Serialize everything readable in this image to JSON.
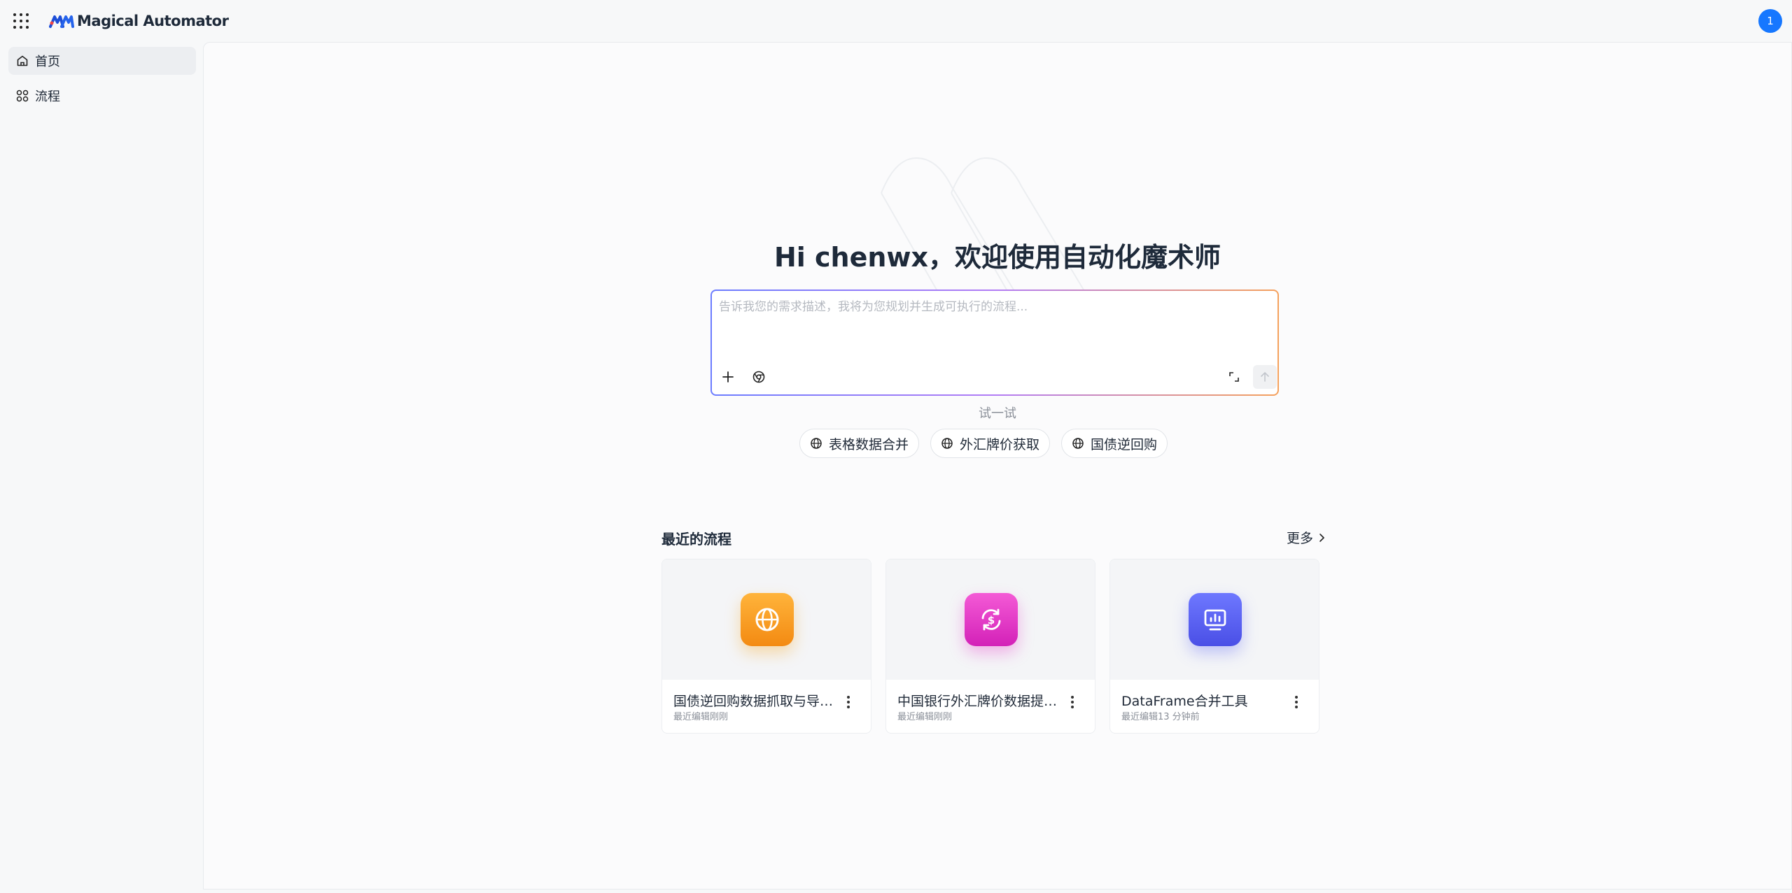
{
  "app": {
    "name": "Magical Automator"
  },
  "user": {
    "avatar_text": "1"
  },
  "sidebar": {
    "items": [
      {
        "label": "首页",
        "icon": "home-icon",
        "active": true
      },
      {
        "label": "流程",
        "icon": "apps-grid-icon",
        "active": false
      }
    ]
  },
  "main": {
    "welcome": "Hi chenwx，欢迎使用自动化魔术师",
    "prompt": {
      "placeholder": "告诉我您的需求描述，我将为您规划并生成可执行的流程...",
      "value": ""
    },
    "try_label": "试一试",
    "suggestions": [
      {
        "label": "表格数据合并",
        "icon": "globe-icon"
      },
      {
        "label": "外汇牌价获取",
        "icon": "globe-icon"
      },
      {
        "label": "国债逆回购",
        "icon": "globe-icon"
      }
    ],
    "recent": {
      "title": "最近的流程",
      "more_label": "更多",
      "cards": [
        {
          "title": "国债逆回购数据抓取与导出...",
          "subtitle": "最近编辑刚刚",
          "icon": "globe-icon",
          "color": "#f7a21b"
        },
        {
          "title": "中国银行外汇牌价数据提取...",
          "subtitle": "最近编辑刚刚",
          "icon": "currency-exchange-icon",
          "color": "#e535c9"
        },
        {
          "title": "DataFrame合并工具",
          "subtitle": "最近编辑13 分钟前",
          "icon": "dashboard-monitor-icon",
          "color": "#5b63f5"
        }
      ]
    }
  },
  "colors": {
    "accent": "#1677ff"
  }
}
